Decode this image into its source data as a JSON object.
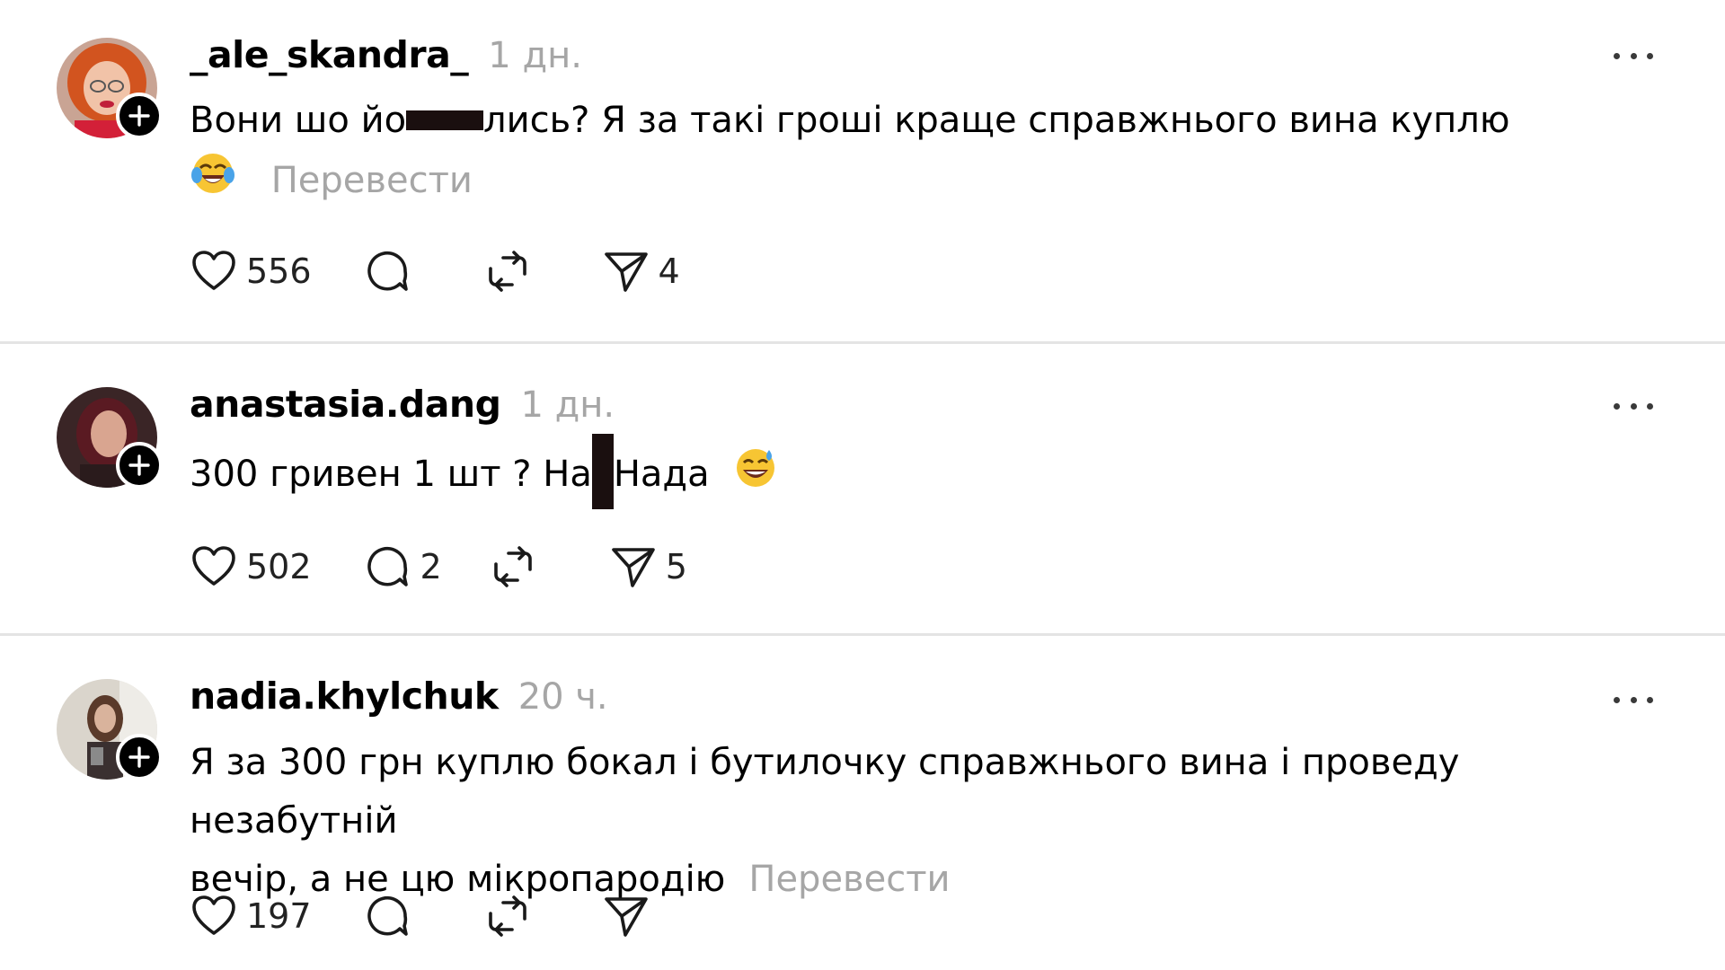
{
  "posts": [
    {
      "username": "_ale_skandra_",
      "time": "1 дн.",
      "text_part1": "Вони шо йо",
      "text_part2": "лись? Я за такі гроші краще справжнього вина куплю",
      "emoji": "tears-of-joy-emoji",
      "translate_label": "Перевести",
      "likes": "556",
      "replies": "",
      "reposts": "",
      "shares": "4"
    },
    {
      "username": "anastasia.dang",
      "time": "1 дн.",
      "text_part1": "300 гривен 1 шт ? На",
      "text_part2": "Нада",
      "emoji": "grinning-sweat-emoji",
      "likes": "502",
      "replies": "2",
      "reposts": "",
      "shares": "5"
    },
    {
      "username": "nadia.khylchuk",
      "time": "20 ч.",
      "text_line1": "Я за 300 грн куплю бокал і бутилочку справжнього вина і проведу незабутній",
      "text_line2": "вечір, а не цю мікропародію",
      "translate_label": "Перевести",
      "likes": "197",
      "replies": "",
      "reposts": "",
      "shares": ""
    }
  ],
  "colors": {
    "text": "#000000",
    "muted": "#a6a6a6",
    "divider": "#e4e4e4",
    "badge": "#000000"
  },
  "icons": [
    "heart-icon",
    "reply-icon",
    "repost-icon",
    "share-icon",
    "more-icon",
    "follow-plus-icon"
  ]
}
